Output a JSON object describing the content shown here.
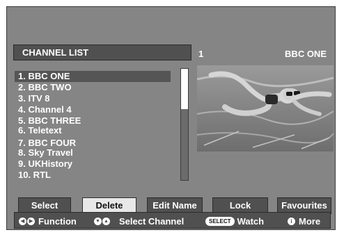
{
  "header": {
    "title": "CHANNEL LIST",
    "current_number": "1",
    "current_name": "BBC ONE"
  },
  "channels": [
    "1. BBC ONE",
    "2. BBC TWO",
    "3. ITV 8",
    "4. Channel 4",
    "5. BBC THREE",
    "6. Teletext",
    "7. BBC FOUR",
    "8. Sky Travel",
    "9. UKHistory",
    "10. RTL"
  ],
  "buttons": {
    "select": "Select",
    "delete": "Delete",
    "edit_name": "Edit Name",
    "lock": "Lock",
    "favourites": "Favourites"
  },
  "footer": {
    "function": "Function",
    "select_channel": "Select Channel",
    "select_key": "SELECT",
    "watch": "Watch",
    "info_key": "i",
    "more": "More"
  }
}
